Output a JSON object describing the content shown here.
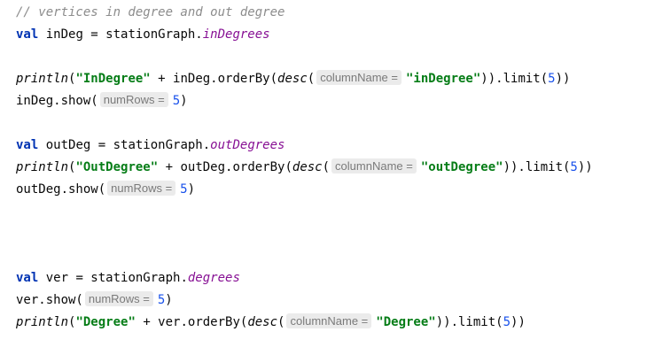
{
  "editor": {
    "lines": [
      [
        {
          "t": "comment",
          "v": "// vertices in degree and out degree"
        }
      ],
      [
        {
          "t": "keyword",
          "v": "val"
        },
        {
          "t": "plain",
          "v": " inDeg = stationGraph."
        },
        {
          "t": "prop",
          "v": "inDegrees"
        }
      ],
      [],
      [
        {
          "t": "fn",
          "v": "println"
        },
        {
          "t": "plain",
          "v": "("
        },
        {
          "t": "string",
          "v": "\"InDegree\""
        },
        {
          "t": "plain",
          "v": " + inDeg.orderBy("
        },
        {
          "t": "fn",
          "v": "desc"
        },
        {
          "t": "plain",
          "v": "("
        },
        {
          "t": "hint",
          "v": "columnName ="
        },
        {
          "t": "string",
          "v": "\"inDegree\""
        },
        {
          "t": "plain",
          "v": ")).limit("
        },
        {
          "t": "num",
          "v": "5"
        },
        {
          "t": "plain",
          "v": "))"
        }
      ],
      [
        {
          "t": "plain",
          "v": "inDeg.show("
        },
        {
          "t": "hint",
          "v": "numRows ="
        },
        {
          "t": "num",
          "v": "5"
        },
        {
          "t": "plain",
          "v": ")"
        }
      ],
      [],
      [
        {
          "t": "keyword",
          "v": "val"
        },
        {
          "t": "plain",
          "v": " outDeg = stationGraph."
        },
        {
          "t": "prop",
          "v": "outDegrees"
        }
      ],
      [
        {
          "t": "fn",
          "v": "println"
        },
        {
          "t": "plain",
          "v": "("
        },
        {
          "t": "string",
          "v": "\"OutDegree\""
        },
        {
          "t": "plain",
          "v": " + outDeg.orderBy("
        },
        {
          "t": "fn",
          "v": "desc"
        },
        {
          "t": "plain",
          "v": "("
        },
        {
          "t": "hint",
          "v": "columnName ="
        },
        {
          "t": "string",
          "v": "\"outDegree\""
        },
        {
          "t": "plain",
          "v": ")).limit("
        },
        {
          "t": "num",
          "v": "5"
        },
        {
          "t": "plain",
          "v": "))"
        }
      ],
      [
        {
          "t": "plain",
          "v": "outDeg.show("
        },
        {
          "t": "hint",
          "v": "numRows ="
        },
        {
          "t": "num",
          "v": "5"
        },
        {
          "t": "plain",
          "v": ")"
        }
      ],
      [],
      [],
      [],
      [
        {
          "t": "keyword",
          "v": "val"
        },
        {
          "t": "plain",
          "v": " ver = stationGraph."
        },
        {
          "t": "prop",
          "v": "degrees"
        }
      ],
      [
        {
          "t": "plain",
          "v": "ver.show("
        },
        {
          "t": "hint",
          "v": "numRows ="
        },
        {
          "t": "num",
          "v": "5"
        },
        {
          "t": "plain",
          "v": ")"
        }
      ],
      [
        {
          "t": "fn",
          "v": "println"
        },
        {
          "t": "plain",
          "v": "("
        },
        {
          "t": "string",
          "v": "\"Degree\""
        },
        {
          "t": "plain",
          "v": " + ver.orderBy("
        },
        {
          "t": "fn",
          "v": "desc"
        },
        {
          "t": "plain",
          "v": "("
        },
        {
          "t": "hint",
          "v": "columnName ="
        },
        {
          "t": "string",
          "v": "\"Degree\""
        },
        {
          "t": "plain",
          "v": ")).limit("
        },
        {
          "t": "num",
          "v": "5"
        },
        {
          "t": "plain",
          "v": "))"
        }
      ]
    ]
  },
  "colors": {
    "background": "#ffffff",
    "comment": "#8c8c8c",
    "keyword": "#0033b3",
    "property": "#871094",
    "string": "#067d17",
    "number": "#1750eb",
    "hint_background": "#ebebeb",
    "hint_text": "#7a7a7a"
  }
}
